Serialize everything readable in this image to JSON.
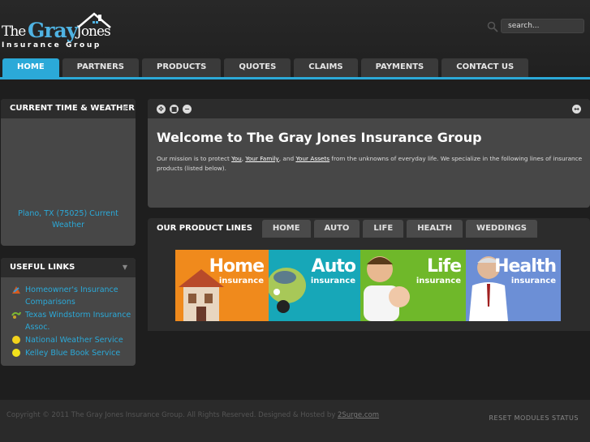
{
  "logo": {
    "the": "The",
    "gray": "Gray",
    "jones": "Jones",
    "group": "Insurance Group"
  },
  "search": {
    "placeholder": "search..."
  },
  "nav": [
    {
      "label": "HOME"
    },
    {
      "label": "PARTNERS"
    },
    {
      "label": "PRODUCTS"
    },
    {
      "label": "QUOTES"
    },
    {
      "label": "CLAIMS"
    },
    {
      "label": "PAYMENTS"
    },
    {
      "label": "CONTACT US"
    }
  ],
  "weather_panel": {
    "title": "CURRENT TIME & WEATHER",
    "location_text": "Plano, TX (75025) Current Weather"
  },
  "links_panel": {
    "title": "USEFUL LINKS",
    "links": [
      {
        "label": "Homeowner's Insurance Comparisons",
        "icon": "house-icon"
      },
      {
        "label": "Texas Windstorm Insurance Assoc.",
        "icon": "wind-icon"
      },
      {
        "label": "National Weather Service",
        "icon": "weather-service-icon"
      },
      {
        "label": "Kelley Blue Book Service",
        "icon": "kbb-icon"
      }
    ]
  },
  "welcome": {
    "title": "Welcome to The Gray Jones Insurance Group",
    "mission_prefix": "Our mission is to protect ",
    "link_you": "You",
    "sep1": ", ",
    "link_family": "Your Family",
    "sep2": ", and ",
    "link_assets": "Your Assets",
    "mission_suffix": " from the unknowns of everyday life.  We specialize in the following lines of insurance products (listed below)."
  },
  "product_tabs": [
    {
      "label": "OUR PRODUCT LINES"
    },
    {
      "label": "HOME"
    },
    {
      "label": "AUTO"
    },
    {
      "label": "LIFE"
    },
    {
      "label": "HEALTH"
    },
    {
      "label": "WEDDINGS"
    }
  ],
  "banner": [
    {
      "big": "Home",
      "small": "insurance",
      "color": "#f08a1c"
    },
    {
      "big": "Auto",
      "small": "insurance",
      "color": "#17a7b8"
    },
    {
      "big": "Life",
      "small": "insurance",
      "color": "#6fb82a"
    },
    {
      "big": "Health",
      "small": "insurance",
      "color": "#6c8fd6"
    }
  ],
  "footer": {
    "copy": "Copyright © 2011 The Gray Jones Insurance Group. All Rights Reserved. Designed & Hosted by ",
    "link": "2Surge.com",
    "reset": "RESET MODULES STATUS"
  },
  "colors": {
    "accent": "#2ba9d8",
    "background": "#1e1e1e",
    "panel": "#474747",
    "panel_header": "#2c2c2c"
  }
}
